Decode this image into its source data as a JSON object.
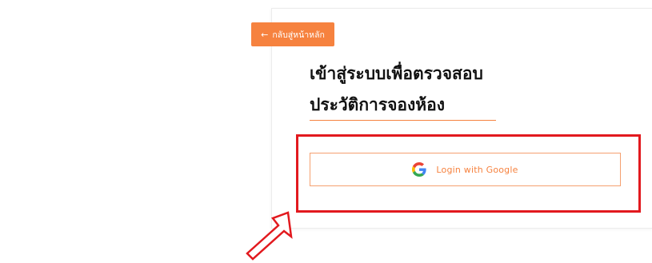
{
  "back_button": {
    "label": "กลับสู่หน้าหลัก",
    "icon": "arrow-left-icon"
  },
  "title": {
    "line1": "เข้าสู่ระบบเพื่อตรวจสอบ",
    "line2": "ประวัติการจองห้อง"
  },
  "login": {
    "google_label": "Login with Google",
    "icon": "google-icon"
  },
  "colors": {
    "accent": "#f6823f",
    "highlight": "#e2191e",
    "title": "#111111"
  }
}
